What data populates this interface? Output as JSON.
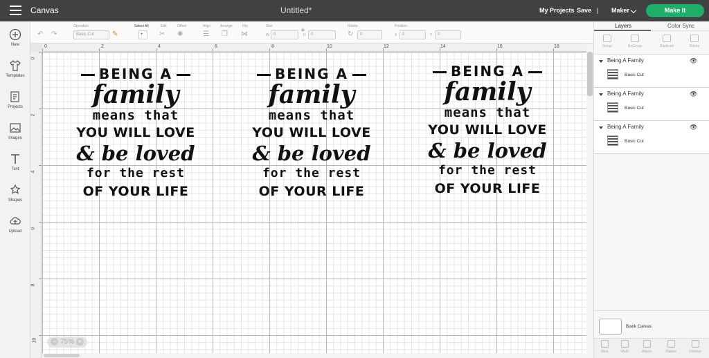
{
  "topbar": {
    "app_label": "Canvas",
    "doc_title": "Untitled*",
    "my_projects": "My Projects",
    "save": "Save",
    "separator": "|",
    "machine": "Maker",
    "make_it": "Make It",
    "accent_color": "#1fae6a"
  },
  "leftnav": [
    {
      "label": "New",
      "icon": "plus-circle-icon"
    },
    {
      "label": "Templates",
      "icon": "tshirt-icon"
    },
    {
      "label": "Projects",
      "icon": "projects-icon"
    },
    {
      "label": "Images",
      "icon": "image-icon"
    },
    {
      "label": "Text",
      "icon": "text-icon"
    },
    {
      "label": "Shapes",
      "icon": "shapes-icon"
    },
    {
      "label": "Upload",
      "icon": "cloud-upload-icon"
    }
  ],
  "toolbar": {
    "operation_label": "Operation",
    "operation_value": "Basic Cut",
    "select_all": "Select All",
    "edit": "Edit",
    "offset": "Offset",
    "align": "Align",
    "arrange": "Arrange",
    "flip": "Flip",
    "size": "Size",
    "w_label": "W",
    "w_value": "0",
    "h_label": "H",
    "h_value": "0",
    "rotate": "Rotate",
    "rotate_value": "0",
    "position": "Position",
    "x_label": "X",
    "x_value": "0",
    "y_label": "Y",
    "y_value": "0"
  },
  "ruler_top": [
    "0",
    "2",
    "4",
    "6",
    "8",
    "10",
    "12",
    "14",
    "16",
    "18"
  ],
  "ruler_left": [
    "0",
    "2",
    "4",
    "6",
    "8",
    "10"
  ],
  "zoom": {
    "value": "75%",
    "minus": "−",
    "plus": "+"
  },
  "designs": [
    {
      "being": "BEING A",
      "family": "family",
      "means": "means that",
      "love": "YOU WILL LOVE",
      "loved": "& be loved",
      "rest": "for the rest",
      "life": "OF YOUR LIFE"
    },
    {
      "being": "BEING A",
      "family": "family",
      "means": "means that",
      "love": "YOU WILL LOVE",
      "loved": "& be loved",
      "rest": "for the rest",
      "life": "OF YOUR LIFE"
    },
    {
      "being": "BEING A",
      "family": "family",
      "means": "means that",
      "love": "YOU WILL LOVE",
      "loved": "& be loved",
      "rest": "for the rest",
      "life": "OF YOUR LIFE"
    }
  ],
  "panel": {
    "tab_layers": "Layers",
    "tab_color_sync": "Color Sync",
    "tools": [
      "Group",
      "UnGroup",
      "Duplicate",
      "Delete"
    ],
    "layers": [
      {
        "name": "Being A Family",
        "operation": "Basic Cut"
      },
      {
        "name": "Being A Family",
        "operation": "Basic Cut"
      },
      {
        "name": "Being A Family",
        "operation": "Basic Cut"
      }
    ],
    "blank_canvas": "Blank Canvas",
    "bottom_tools": [
      "Slice",
      "Weld",
      "Attach",
      "Flatten",
      "Contour"
    ]
  }
}
